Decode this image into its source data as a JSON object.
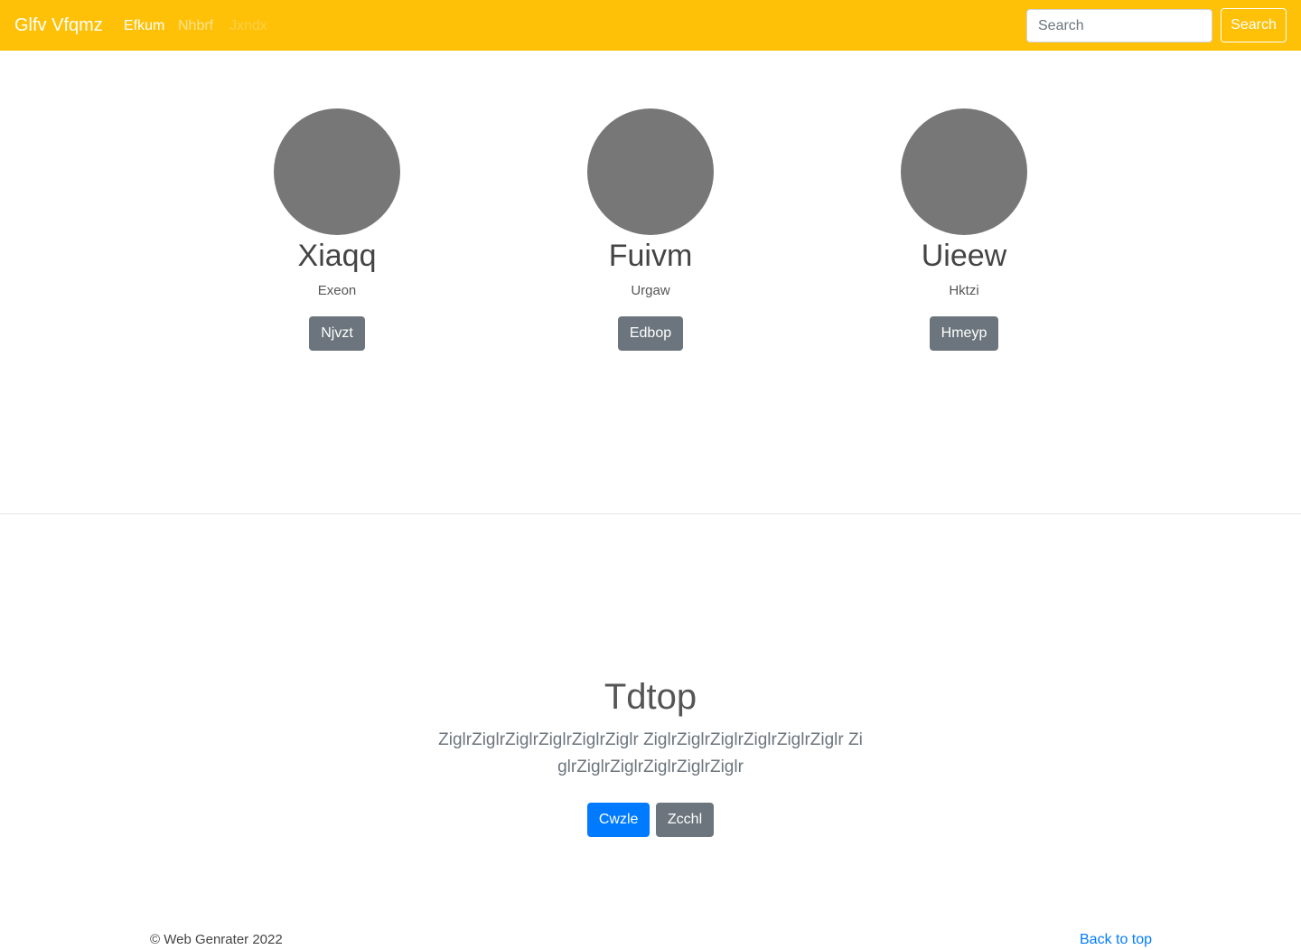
{
  "navbar": {
    "brand": "Glfv Vfqmz",
    "links": [
      "Efkum",
      "Nhbrf",
      "Jxndx"
    ],
    "search_placeholder": "Search",
    "search_button": "Search"
  },
  "people": [
    {
      "name": "Xiaqq",
      "role": "Exeon",
      "button": "Njvzt"
    },
    {
      "name": "Fuivm",
      "role": "Urgaw",
      "button": "Edbop"
    },
    {
      "name": "Uieew",
      "role": "Hktzi",
      "button": "Hmeyp"
    }
  ],
  "hero": {
    "title": "Tdtop",
    "text": "ZiglrZiglrZiglrZiglrZiglrZiglr ZiglrZiglrZiglrZiglrZiglrZiglr ZiglrZiglrZiglrZiglrZiglrZiglr",
    "primary_button": "Cwzle",
    "secondary_button": "Zcchl"
  },
  "footer": {
    "copyright": "© Web Genrater 2022",
    "back_to_top": "Back to top"
  },
  "colors": {
    "navbar": "#ffc107",
    "avatar": "#777777",
    "secondary": "#6c757d",
    "primary": "#007bff"
  }
}
